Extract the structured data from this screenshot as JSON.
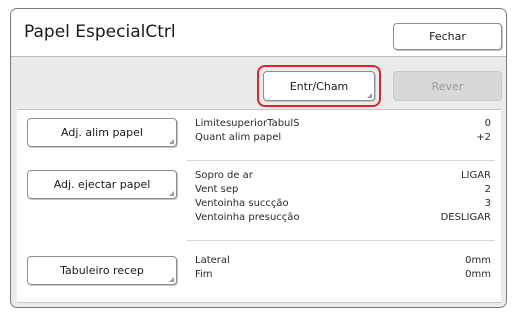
{
  "window": {
    "title": "Papel EspecialCtrl"
  },
  "header": {
    "close_label": "Fechar"
  },
  "toolbar": {
    "entry_label": "Entr/Cham",
    "review_label": "Rever"
  },
  "groups": [
    {
      "button_label": "Adj. alim papel",
      "rows": [
        {
          "label": "LimitesuperiorTabulS",
          "value": "0"
        },
        {
          "label": "Quant alim papel",
          "value": "+2"
        }
      ]
    },
    {
      "button_label": "Adj. ejectar papel",
      "rows": [
        {
          "label": "Sopro de ar",
          "value": "LIGAR"
        },
        {
          "label": "Vent sep",
          "value": "2"
        },
        {
          "label": "Ventoinha succção",
          "value": "3"
        },
        {
          "label": "Ventoinha presucção",
          "value": "DESLIGAR"
        }
      ]
    },
    {
      "button_label": "Tabuleiro recep",
      "rows": [
        {
          "label": "Lateral",
          "value": "0mm"
        },
        {
          "label": "Fim",
          "value": "0mm"
        }
      ]
    }
  ],
  "colors": {
    "highlight": "#e0232a",
    "background": "#ebebeb"
  }
}
